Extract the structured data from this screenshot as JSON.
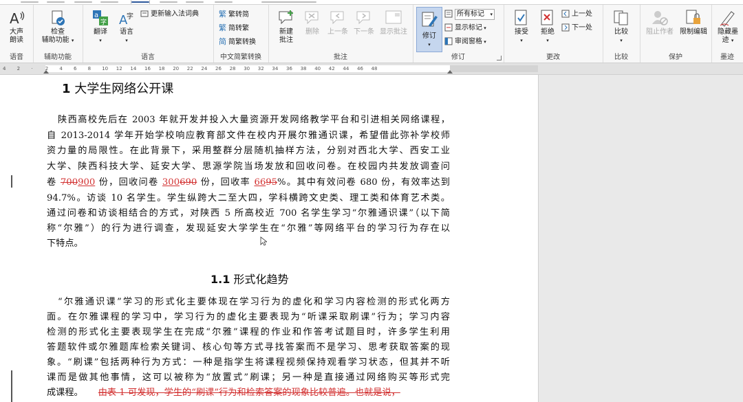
{
  "ribbon": {
    "groups": {
      "speech": {
        "label": "语音",
        "read_aloud": "大声\n朗读"
      },
      "accessibility": {
        "label": "辅助功能",
        "check": "检查\n辅助功能"
      },
      "language": {
        "label": "语言",
        "translate": "翻译",
        "language": "语言",
        "update_ime": "更新输入法词典"
      },
      "chinese_conv": {
        "label": "中文简繁转换",
        "to_trad": "繁转简",
        "to_simp": "简转繁",
        "conv": "简繁转换"
      },
      "comments": {
        "label": "批注",
        "new": "新建\n批注",
        "delete": "删除",
        "prev": "上一条",
        "next": "下一条",
        "show": "显示批注"
      },
      "tracking": {
        "label": "修订",
        "track": "修订",
        "markup_select": "所有标记",
        "show_markup": "显示标记",
        "review_pane": "审阅窗格"
      },
      "changes": {
        "label": "更改",
        "accept": "接受",
        "reject": "拒绝",
        "prev": "上一处",
        "next": "下一处"
      },
      "compare": {
        "label": "比较",
        "compare": "比较"
      },
      "protect": {
        "label": "保护",
        "block_authors": "阻止作者",
        "restrict": "限制编辑"
      },
      "ink": {
        "label": "墨迹",
        "hide_ink": "隐藏墨\n迹"
      }
    }
  },
  "ruler": {
    "ticks": [
      "4",
      "2",
      "",
      "2",
      "4",
      "6",
      "8",
      "10",
      "12",
      "14",
      "16",
      "18",
      "20",
      "22",
      "24",
      "26",
      "28",
      "30",
      "32",
      "34",
      "36",
      "38",
      "40",
      "42",
      "44",
      "46",
      "48"
    ]
  },
  "document": {
    "h1_num": "1",
    "h1_text": "大学生网络公开课",
    "p1": [
      "陕西高校先后在 2003 年就开发并投入大量资源开发网络教学平台和引进相关网络课程，",
      "自 2013-2014 学年开始学校响应教育部文件在校内开展尔雅通识课，希望借此弥补学校师",
      "资力量的局限性。在此背景下，采用整群分层随机抽样方法，分别对西北大学、西安工业",
      "大学、陕西科技大学、延安大学、思源学院当场发放和回收问卷。在校园内共发放调查问"
    ],
    "p1_l5": {
      "a": "卷 ",
      "del1": "700",
      "ins1": "900",
      "b": " 份，回收问卷 ",
      "ins2": "300",
      "del2": "690",
      "c": " 份，回收率 ",
      "ins3": "66",
      "del3": "95",
      "d": "%。其中有效问卷 680 份，有效率达到"
    },
    "p1_rest": [
      "94.7%。访谈 10 名学生。学生纵跨大二至大四，学科横跨文史类、理工类和体育艺术类。",
      "通过问卷和访谈相结合的方式，对陕西 5 所高校近 700 名学生学习“尔雅通识课”（以下简",
      "称“尔雅”）的行为进行调查，发现延安大学学生在“尔雅”等网络平台的学习行为存在以",
      "下特点。"
    ],
    "h2_num": "1.1",
    "h2_text": "形式化趋势",
    "p2": [
      "“尔雅通识课”学习的形式化主要体现在学习行为的虚化和学习内容检测的形式化两方",
      "面。在尔雅课程的学习中，学习行为的虚化主要表现为“听课采取刷课”行为；学习内容",
      "检测的形式化主要表现学生在完成“尔雅”课程的作业和作答考试题目时，许多学生利用",
      "答题软件或尔雅题库检索关键词、核心句等方式寻找答案而不是学习、思考获取答案的现",
      "象。“刷课”包括两种行为方式：一种是指学生将课程视频保持观看学习状态，但其并不听",
      "课而是做其他事情，这可以被称为“放置式”刷课；另一种是直接通过网络购买等形式完"
    ],
    "p2_last": {
      "a": "成课程。",
      "del": "由表 1 可发现，学生的“刷课”行为和检索答案的现象比较普遍。也就是说，"
    }
  }
}
